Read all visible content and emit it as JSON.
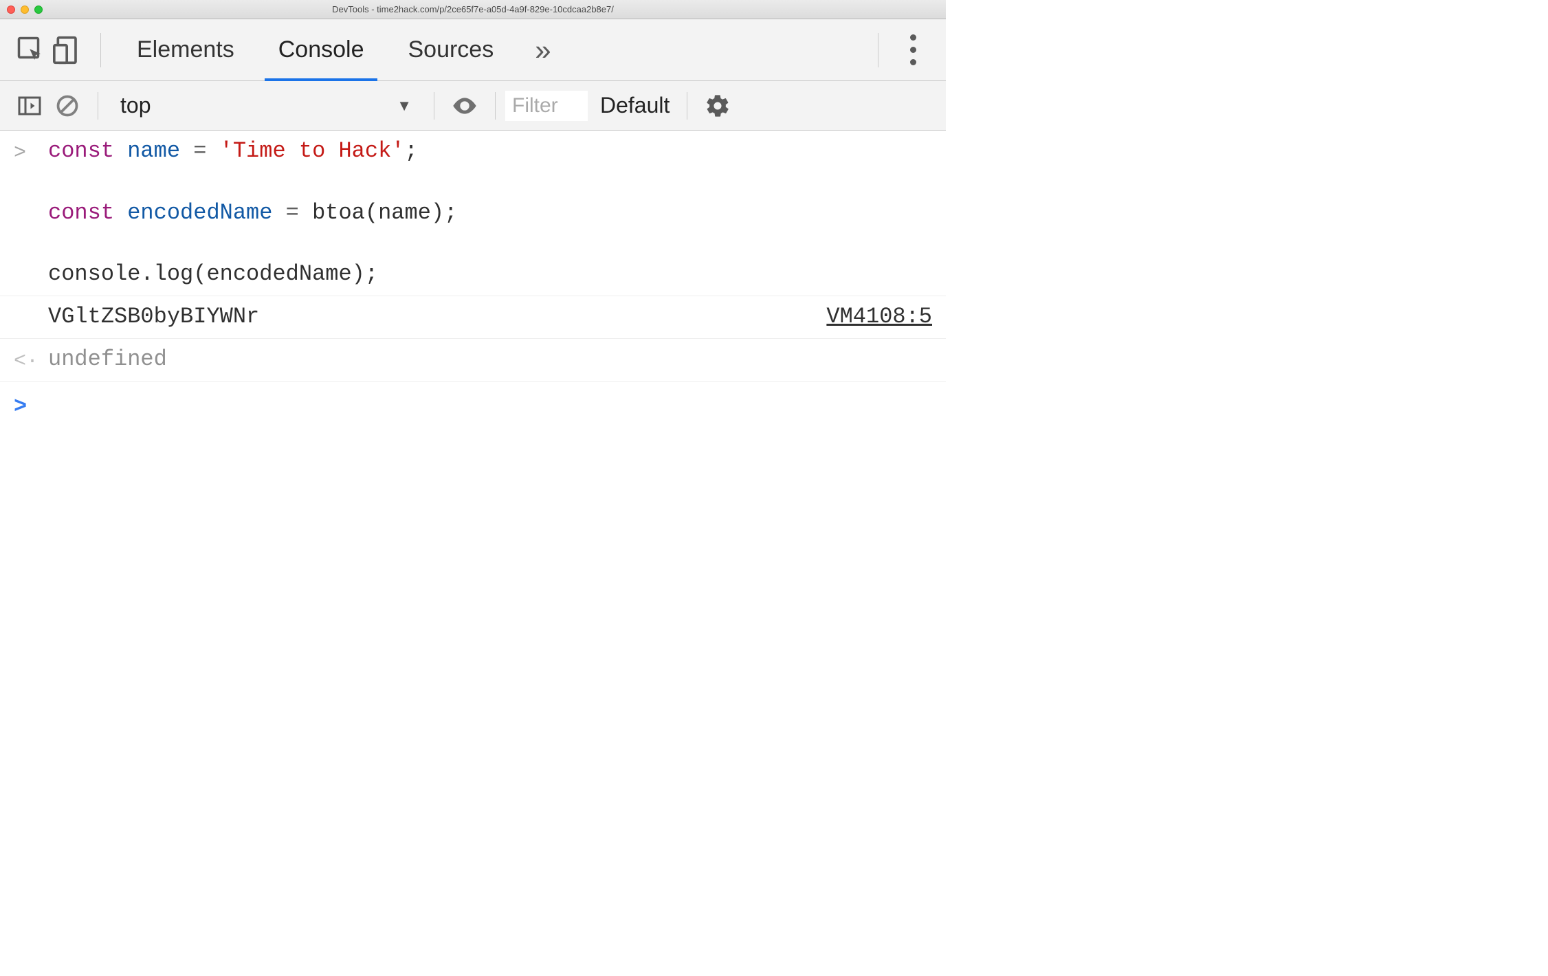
{
  "window": {
    "title": "DevTools - time2hack.com/p/2ce65f7e-a05d-4a9f-829e-10cdcaa2b8e7/"
  },
  "tabs": {
    "elements": "Elements",
    "console": "Console",
    "sources": "Sources",
    "more": "»"
  },
  "toolbar": {
    "context": "top",
    "filter_placeholder": "Filter",
    "levels_label": "Default"
  },
  "console": {
    "input_prompt": ">",
    "return_prompt": "<·",
    "active_prompt": ">",
    "code": {
      "l1_kw": "const",
      "l1_var": " name",
      "l1_op": " = ",
      "l1_str": "'Time to Hack'",
      "l1_semi": ";",
      "blank": "",
      "l2_kw": "const",
      "l2_var": " encodedName",
      "l2_op": " = ",
      "l2_fn": "btoa(name);",
      "l3": "console.log(encodedName);"
    },
    "output": "VGltZSB0byBIYWNr",
    "source": "VM4108:5",
    "return_value": "undefined"
  }
}
